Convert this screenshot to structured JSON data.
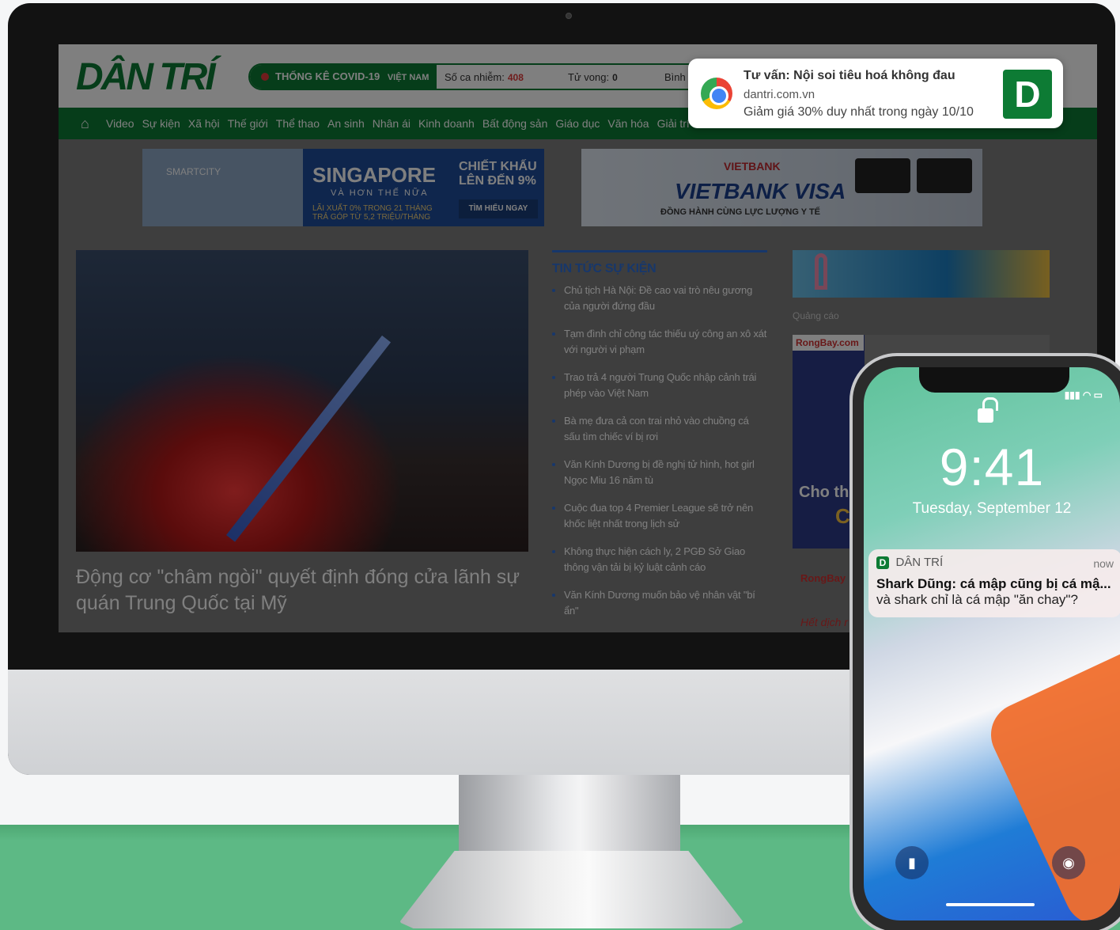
{
  "site": {
    "logo": "DÂN TRÍ",
    "covid": {
      "tag": "THỐNG KÊ COVID-19",
      "country": "VIỆT NAM",
      "infected_label": "Số ca nhiễm:",
      "infected_value": "408",
      "deaths_label": "Tử vong:",
      "deaths_value": "0",
      "recovered_label": "Bình ph"
    },
    "nav": [
      "Video",
      "Sự kiện",
      "Xã hội",
      "Thế giới",
      "Thể thao",
      "An sinh",
      "Nhân ái",
      "Kinh doanh",
      "Bất động sản",
      "Giáo dục",
      "Văn hóa",
      "Giải trí"
    ],
    "ads": {
      "ad1_brand": "SMARTCITY",
      "ad1_headline": "SINGAPORE",
      "ad1_sub": "VÀ HƠN THẾ NỮA",
      "ad1_offer": "CHIẾT KHẤU LÊN ĐẾN 9%",
      "ad1_terms": "LÃI XUẤT 0% TRONG 21 THÁNG TRẢ GÓP TỪ 5,2 TRIỆU/THÁNG",
      "ad1_cta": "TÌM HIỂU NGAY",
      "ad2_brand": "VIETBANK",
      "ad2_headline": "VIETBANK VISA",
      "ad2_sub": "ĐỒNG HÀNH CÙNG LỰC LƯỢNG Y TẾ",
      "side_label": "Quảng cáo",
      "side_brand": "RongBay.com",
      "side_text1": "Cho thu",
      "side_text2": "Ch",
      "side_brand2": "RongBay",
      "side_footer": "Hết dịch r"
    },
    "hero_title": "Động cơ \"châm ngòi\" quyết định đóng cửa lãnh sự quán Trung Quốc tại Mỹ",
    "news": {
      "heading": "TIN TỨC SỰ KIỆN",
      "items": [
        "Chủ tịch Hà Nội: Đề cao vai trò nêu gương của người đứng đầu",
        "Tạm đình chỉ công tác thiếu uý công an xô xát với người vi phạm",
        "Trao trả 4 người Trung Quốc nhập cảnh trái phép vào Việt Nam",
        "Bà mẹ đưa cả con trai nhỏ vào chuồng cá sấu tìm chiếc ví bị rơi",
        "Văn Kính Dương bị đề nghị tử hình, hot girl Ngọc Miu 16 năm tù",
        "Cuộc đua top 4 Premier League sẽ trở nên khốc liệt nhất trong lịch sử",
        "Không thực hiện cách ly, 2 PGĐ Sở Giao thông vận tải bị kỷ luật cảnh cáo",
        "Văn Kính Dương muốn bảo vệ nhân vật \"bí ẩn\""
      ]
    }
  },
  "chrome_notification": {
    "title": "Tư vấn: Nội soi tiêu hoá không đau",
    "source": "dantri.com.vn",
    "body": "Giảm giá 30% duy nhất trong ngày 10/10",
    "badge": "D"
  },
  "phone": {
    "time": "9:41",
    "date": "Tuesday, September 12",
    "notification": {
      "icon": "D",
      "app": "DÂN TRÍ",
      "when": "now",
      "title": "Shark Dũng: cá mập cũng bị cá mậ...",
      "body": "và shark chỉ là cá mập \"ăn chay\"?"
    }
  },
  "colors": {
    "brand_green": "#0d7b34",
    "floor_green": "#5db985",
    "link_blue": "#2f6fd6"
  }
}
